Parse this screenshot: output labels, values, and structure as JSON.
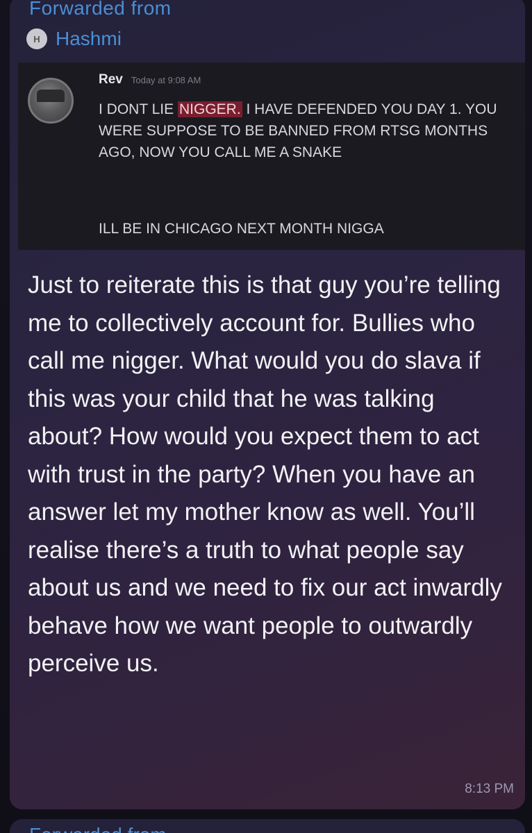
{
  "forward": {
    "label": "Forwarded from",
    "source_name": "Hashmi",
    "source_avatar_initial": "H"
  },
  "embedded_message": {
    "username": "Rev",
    "timestamp": "Today at 9:08 AM",
    "text_before": "I DONT LIE ",
    "highlighted": "NIGGER.",
    "text_after": " I HAVE DEFENDED YOU DAY 1. YOU WERE SUPPOSE TO BE BANNED FROM RTSG MONTHS AGO, NOW YOU CALL ME A SNAKE",
    "last_line": "ILL BE IN CHICAGO NEXT MONTH NIGGA"
  },
  "message": {
    "text": "Just to reiterate this is that guy you’re telling me to collectively account for. Bullies who call me nigger. What would you do slava if this was your child that he was talking about? How would you expect them to act with trust in the party? When you have an answer let my mother know as well. You’ll realise there’s a truth to what people say about us and we need to fix our act inwardly behave how we want people to outwardly perceive us.",
    "time": "8:13 PM"
  },
  "next_forward": {
    "label": "Forwarded from"
  },
  "colors": {
    "link_blue": "#4a8fd6",
    "highlight_red": "#7a1e2e"
  }
}
